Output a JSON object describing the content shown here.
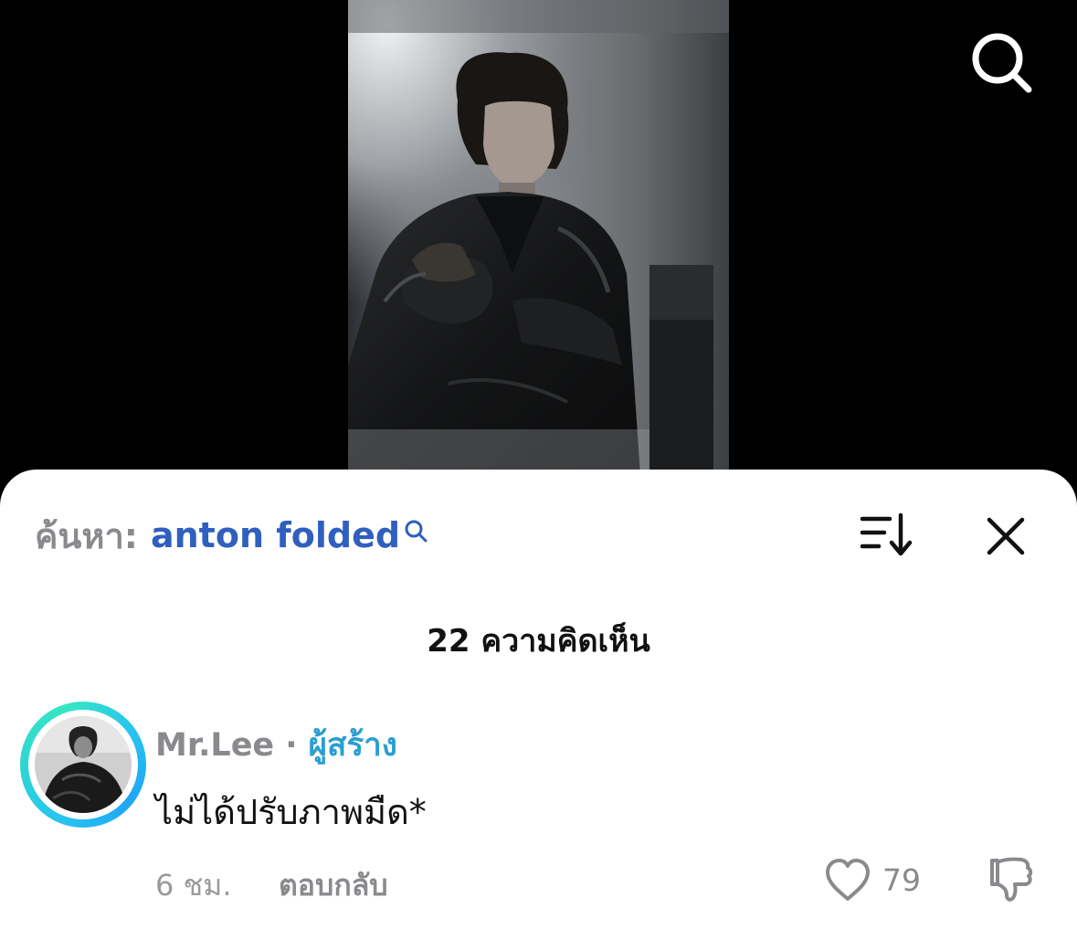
{
  "search_query": {
    "prefix": "ค้นหา:",
    "term": "anton folded"
  },
  "comments_header": {
    "count_label": "22 ความคิดเห็น"
  },
  "comment": {
    "author": "Mr.Lee",
    "separator": "·",
    "badge": "ผู้สร้าง",
    "text": "ไม่ได้ปรับภาพมืด*",
    "time": "6 ชม.",
    "reply_label": "ตอบกลับ",
    "like_count": "79"
  },
  "icons": {
    "top_search": "search-icon",
    "query_search": "search-icon",
    "sort": "sort-icon",
    "close": "close-icon",
    "like": "heart-icon",
    "dislike": "thumbs-down-icon"
  },
  "colors": {
    "query_term": "#2f5fbf",
    "creator_badge": "#2a9fd0",
    "avatar_ring": "#27c4f0"
  }
}
